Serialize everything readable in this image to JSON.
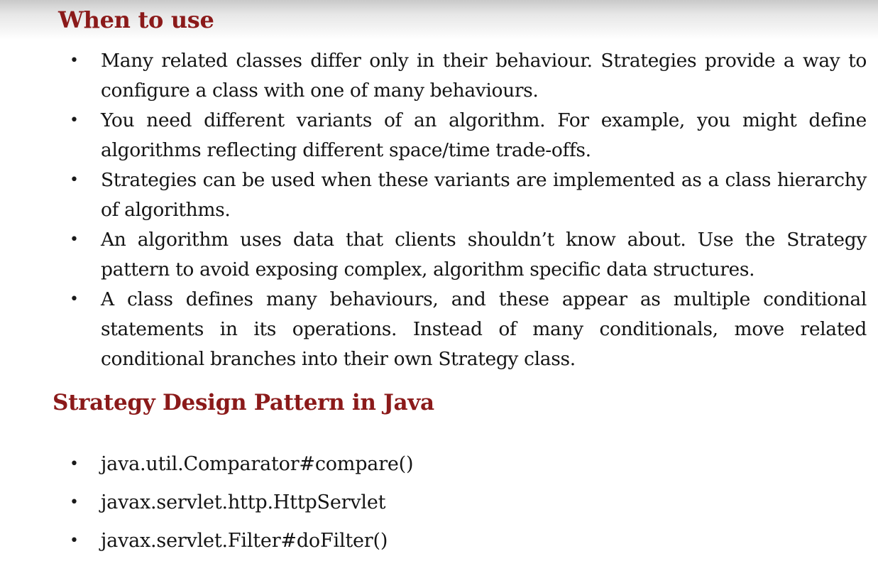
{
  "section1": {
    "title": "When to use",
    "items": [
      "Many related classes differ only in their behaviour. Strategies provide a way to configure a class with one of many behaviours.",
      "You need different variants of an algorithm. For example, you might define algorithms reflecting different space/time trade-offs.",
      "Strategies can be used when these variants are implemented as a class hierarchy of algorithms.",
      "An algorithm uses data that clients shouldn’t know about. Use the Strategy pattern to avoid exposing complex, algorithm specific data structures.",
      "A class defines many behaviours, and these appear as multiple conditional statements in its operations. Instead of many conditionals, move related conditional branches into their own Strategy class."
    ]
  },
  "section2": {
    "title": "Strategy Design Pattern in Java",
    "items": [
      "java.util.Comparator#compare()",
      "javax.servlet.http.HttpServlet",
      "javax.servlet.Filter#doFilter()"
    ]
  },
  "bullet_glyph": "•",
  "colors": {
    "heading": "#8b1a1a",
    "text": "#141414"
  }
}
